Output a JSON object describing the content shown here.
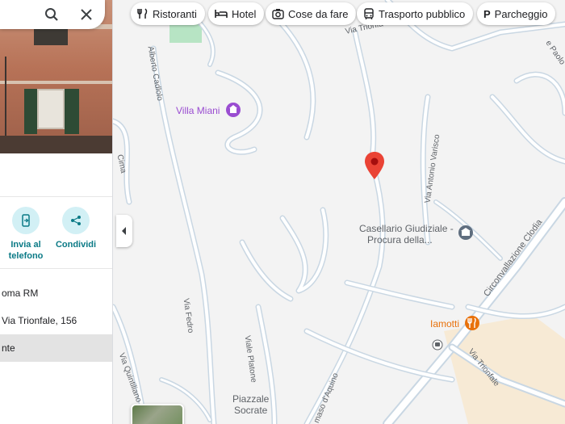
{
  "search": {
    "search_icon": "search-icon",
    "close_icon": "close-icon"
  },
  "actions": [
    {
      "label_line1": "Invia al",
      "label_line2": "telefono",
      "icon": "send-to-phone-icon"
    },
    {
      "label_line1": "Condividi",
      "label_line2": "",
      "icon": "share-icon"
    }
  ],
  "info_rows": [
    {
      "text": "oma RM"
    },
    {
      "text": "Via Trionfale, 156"
    },
    {
      "text": "nte"
    }
  ],
  "chips": [
    {
      "label": "Ristoranti",
      "icon": "fork-knife-icon"
    },
    {
      "label": "Hotel",
      "icon": "bed-icon"
    },
    {
      "label": "Cose da fare",
      "icon": "camera-icon"
    },
    {
      "label": "Trasporto pubblico",
      "icon": "bus-icon"
    },
    {
      "label": "Parcheggio",
      "icon": "parking-icon"
    }
  ],
  "map": {
    "pois": {
      "villa_miani": "Villa Miani",
      "casellario_line1": "Casellario Giudiziale -",
      "casellario_line2": "Procura della...",
      "iamotti": "Iamotti",
      "piazzale_line1": "Piazzale",
      "piazzale_line2": "Socrate"
    },
    "streets": {
      "alberto_cadlolo": "Alberto Cadlolo",
      "via_trionfale_top": "Via Trionfa",
      "pasolo": "e Paolo",
      "via_antonio_varisco": "Via Antonio Varisco",
      "cima": "Cima",
      "circonvallazione": "Circonvallazione Clodia",
      "via_fedro": "Via Fedro",
      "via_trionfale": "Via Trionfale",
      "via_quintiliano": "Via Quintiliano",
      "viale_platone": "Viale Platone",
      "masso_d_aquino": "maso d'Aquino"
    },
    "colors": {
      "poi_purple": "#9a4dd1",
      "restaurant_orange": "#e8710a",
      "pin_red": "#ea4335",
      "road": "#c9d7e3",
      "park": "#b7e4c4",
      "sand": "#f7ead5"
    }
  }
}
